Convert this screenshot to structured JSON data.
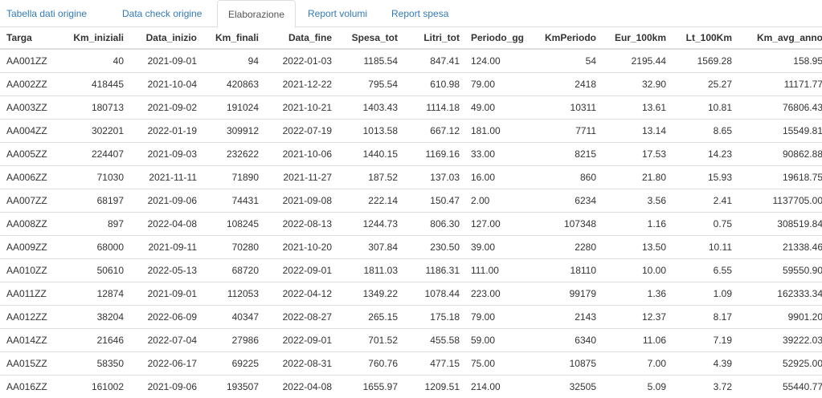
{
  "tabs": [
    {
      "label": "Tabella dati origine",
      "active": false
    },
    {
      "label": "Data check origine",
      "active": false
    },
    {
      "label": "Elaborazione",
      "active": true
    },
    {
      "label": "Report volumi",
      "active": false
    },
    {
      "label": "Report spesa",
      "active": false
    }
  ],
  "table": {
    "headers": [
      "Targa",
      "Km_iniziali",
      "Data_inizio",
      "Km_finali",
      "Data_fine",
      "Spesa_tot",
      "Litri_tot",
      "Periodo_gg",
      "KmPeriodo",
      "Eur_100km",
      "Lt_100Km",
      "Km_avg_anno"
    ],
    "rows": [
      [
        "AA001ZZ",
        "40",
        "2021-09-01",
        "94",
        "2022-01-03",
        "1185.54",
        "847.41",
        "124.00",
        "54",
        "2195.44",
        "1569.28",
        "158.95"
      ],
      [
        "AA002ZZ",
        "418445",
        "2021-10-04",
        "420863",
        "2021-12-22",
        "795.54",
        "610.98",
        "79.00",
        "2418",
        "32.90",
        "25.27",
        "11171.77"
      ],
      [
        "AA003ZZ",
        "180713",
        "2021-09-02",
        "191024",
        "2021-10-21",
        "1403.43",
        "1114.18",
        "49.00",
        "10311",
        "13.61",
        "10.81",
        "76806.43"
      ],
      [
        "AA004ZZ",
        "302201",
        "2022-01-19",
        "309912",
        "2022-07-19",
        "1013.58",
        "667.12",
        "181.00",
        "7711",
        "13.14",
        "8.65",
        "15549.81"
      ],
      [
        "AA005ZZ",
        "224407",
        "2021-09-03",
        "232622",
        "2021-10-06",
        "1440.15",
        "1169.16",
        "33.00",
        "8215",
        "17.53",
        "14.23",
        "90862.88"
      ],
      [
        "AA006ZZ",
        "71030",
        "2021-11-11",
        "71890",
        "2021-11-27",
        "187.52",
        "137.03",
        "16.00",
        "860",
        "21.80",
        "15.93",
        "19618.75"
      ],
      [
        "AA007ZZ",
        "68197",
        "2021-09-06",
        "74431",
        "2021-09-08",
        "222.14",
        "150.47",
        "2.00",
        "6234",
        "3.56",
        "2.41",
        "1137705.00"
      ],
      [
        "AA008ZZ",
        "897",
        "2022-04-08",
        "108245",
        "2022-08-13",
        "1244.73",
        "806.30",
        "127.00",
        "107348",
        "1.16",
        "0.75",
        "308519.84"
      ],
      [
        "AA009ZZ",
        "68000",
        "2021-09-11",
        "70280",
        "2021-10-20",
        "307.84",
        "230.50",
        "39.00",
        "2280",
        "13.50",
        "10.11",
        "21338.46"
      ],
      [
        "AA010ZZ",
        "50610",
        "2022-05-13",
        "68720",
        "2022-09-01",
        "1811.03",
        "1186.31",
        "111.00",
        "18110",
        "10.00",
        "6.55",
        "59550.90"
      ],
      [
        "AA011ZZ",
        "12874",
        "2021-09-01",
        "112053",
        "2022-04-12",
        "1349.22",
        "1078.44",
        "223.00",
        "99179",
        "1.36",
        "1.09",
        "162333.34"
      ],
      [
        "AA012ZZ",
        "38204",
        "2022-06-09",
        "40347",
        "2022-08-27",
        "265.15",
        "175.18",
        "79.00",
        "2143",
        "12.37",
        "8.17",
        "9901.20"
      ],
      [
        "AA014ZZ",
        "21646",
        "2022-07-04",
        "27986",
        "2022-09-01",
        "701.52",
        "455.58",
        "59.00",
        "6340",
        "11.06",
        "7.19",
        "39222.03"
      ],
      [
        "AA015ZZ",
        "58350",
        "2022-06-17",
        "69225",
        "2022-08-31",
        "760.76",
        "477.15",
        "75.00",
        "10875",
        "7.00",
        "4.39",
        "52925.00"
      ],
      [
        "AA016ZZ",
        "161002",
        "2021-09-06",
        "193507",
        "2022-04-08",
        "1655.97",
        "1209.51",
        "214.00",
        "32505",
        "5.09",
        "3.72",
        "55440.77"
      ]
    ]
  },
  "colors": {
    "link": "#337ab7",
    "active_tab_text": "#555555",
    "border": "#dddddd",
    "text": "#333333"
  }
}
